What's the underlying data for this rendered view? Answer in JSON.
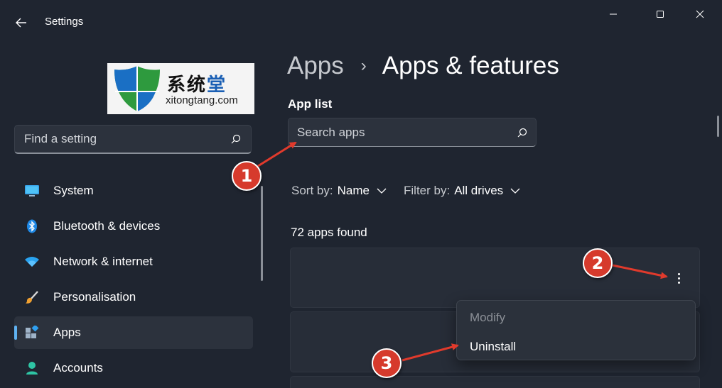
{
  "window": {
    "title": "Settings",
    "back_icon": "arrow-left-icon",
    "minimize_icon": "minimize-icon",
    "maximize_icon": "maximize-icon",
    "close_icon": "close-icon"
  },
  "watermark": {
    "chinese_text": [
      "系",
      "统",
      "堂"
    ],
    "domain": "xitongtang.com",
    "colors": [
      "#1a5fb4",
      "#2e9a3e"
    ]
  },
  "sidebar": {
    "search_placeholder": "Find a setting",
    "search_icon": "search-icon",
    "items": [
      {
        "label": "System",
        "icon": "monitor-icon",
        "active": false
      },
      {
        "label": "Bluetooth & devices",
        "icon": "bluetooth-icon",
        "active": false
      },
      {
        "label": "Network & internet",
        "icon": "wifi-icon",
        "active": false
      },
      {
        "label": "Personalisation",
        "icon": "brush-icon",
        "active": false
      },
      {
        "label": "Apps",
        "icon": "apps-icon",
        "active": true
      },
      {
        "label": "Accounts",
        "icon": "person-icon",
        "active": false
      }
    ],
    "accent_color": "#5fb2f2"
  },
  "main": {
    "breadcrumb": {
      "parent": "Apps",
      "separator": "›",
      "current": "Apps & features"
    },
    "section_title": "App list",
    "search_placeholder": "Search apps",
    "sort": {
      "label": "Sort by:",
      "value": "Name"
    },
    "filter": {
      "label": "Filter by:",
      "value": "All drives"
    },
    "count_text": "72 apps found",
    "more_icon": "more-vertical-icon"
  },
  "context_menu": {
    "items": [
      {
        "label": "Modify",
        "enabled": false
      },
      {
        "label": "Uninstall",
        "enabled": true
      }
    ]
  },
  "annotations": {
    "badges": [
      "1",
      "2",
      "3"
    ],
    "color": "#d63a2c"
  }
}
